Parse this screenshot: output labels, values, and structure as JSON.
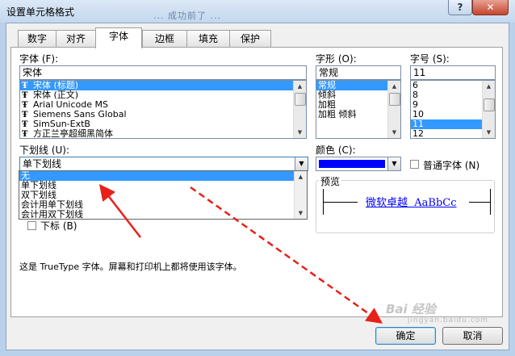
{
  "window": {
    "title": "设置单元格格式",
    "background_ghost": "... 成功前了 ...",
    "help_label": "?",
    "close_label": "✕"
  },
  "tabs": [
    {
      "label": "数字"
    },
    {
      "label": "对齐"
    },
    {
      "label": "字体"
    },
    {
      "label": "边框"
    },
    {
      "label": "填充"
    },
    {
      "label": "保护"
    }
  ],
  "font": {
    "label": "字体 (F):",
    "value": "宋体",
    "items": [
      "宋体 (标题)",
      "宋体 (正文)",
      "Arial Unicode MS",
      "Siemens Sans Global",
      "SimSun-ExtB",
      "方正兰亭超细黑简体"
    ],
    "selected_index": 0
  },
  "style": {
    "label": "字形 (O):",
    "value": "常规",
    "items": [
      "常规",
      "倾斜",
      "加粗",
      "加粗 倾斜"
    ],
    "selected_index": 0
  },
  "size": {
    "label": "字号 (S):",
    "value": "11",
    "items": [
      "6",
      "8",
      "9",
      "10",
      "11",
      "12"
    ],
    "selected_index": 4
  },
  "underline": {
    "label": "下划线 (U):",
    "value": "单下划线",
    "options": [
      "无",
      "单下划线",
      "双下划线",
      "会计用单下划线",
      "会计用双下划线"
    ],
    "highlighted_index": 0
  },
  "color": {
    "label": "颜色 (C):",
    "swatch": "#0000ff"
  },
  "normal_font": {
    "label": "普通字体 (N)"
  },
  "effects": {
    "subscript_label": "下标 (B)"
  },
  "preview": {
    "label": "预览",
    "text": "微软卓越  AaBbCc",
    "text_color": "#0000ff"
  },
  "info_text": "这是 TrueType 字体。屏幕和打印机上都将使用该字体。",
  "buttons": {
    "ok": "确定",
    "cancel": "取消"
  },
  "watermark": {
    "text": "Bai 经验",
    "sub": "jingyan.baidu.com"
  },
  "colors": {
    "selection": "#3399ff",
    "annotation_arrow": "#e8201a"
  }
}
